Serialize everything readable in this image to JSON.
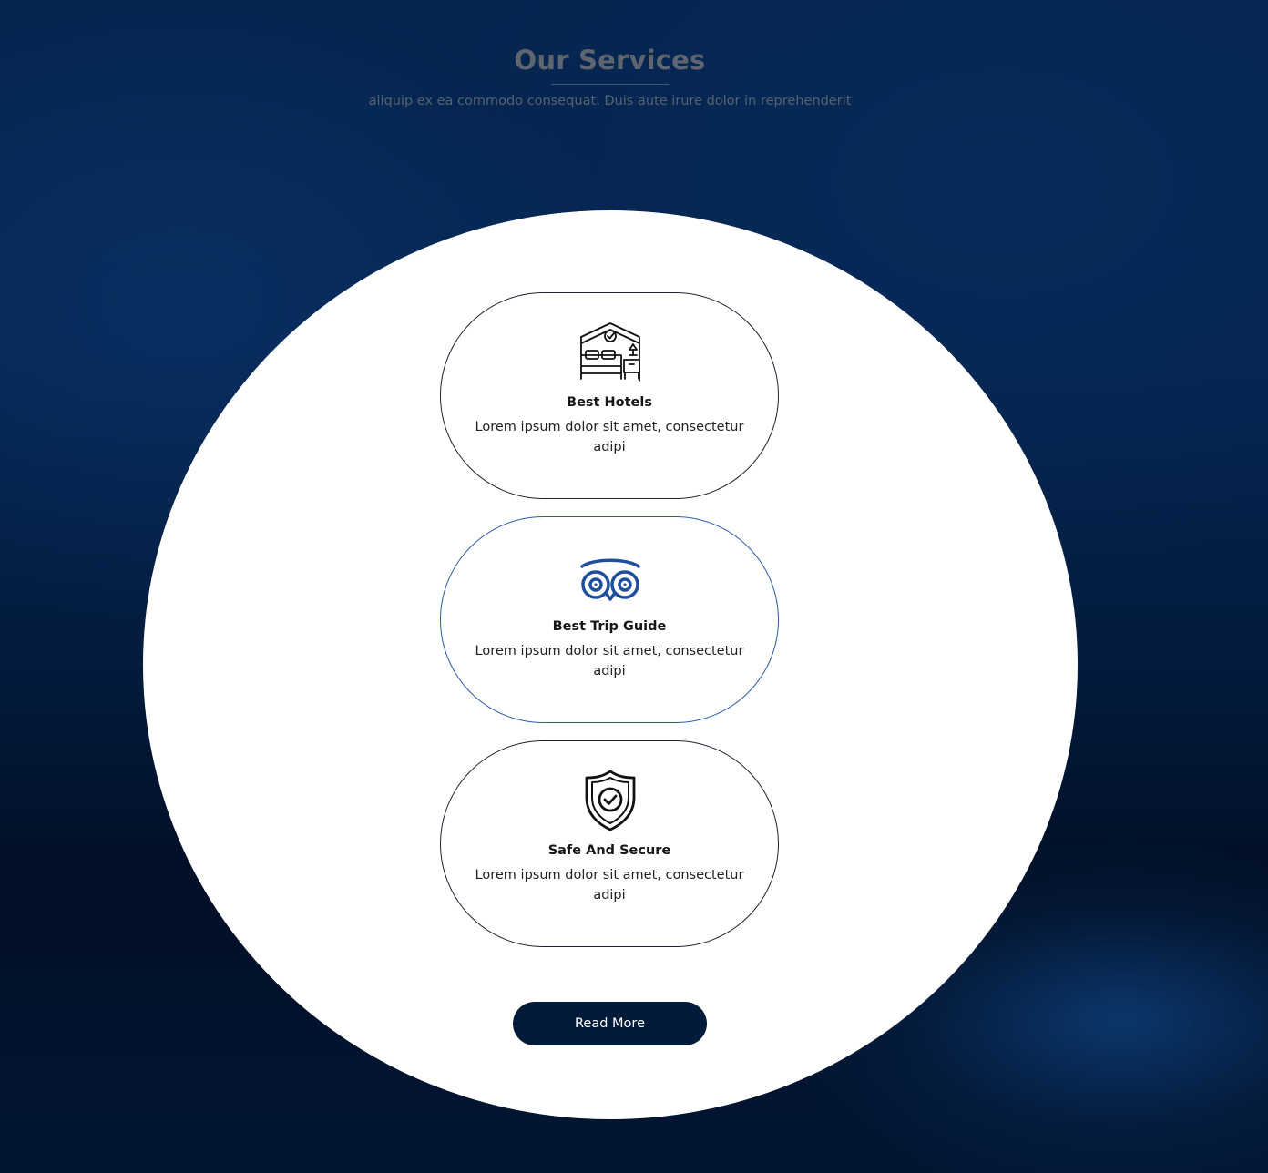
{
  "header": {
    "title": "Our Services",
    "subtitle": "aliquip ex ea commodo consequat. Duis aute irure dolor in reprehenderit"
  },
  "services": [
    {
      "icon": "hotel-icon",
      "title": "Best Hotels",
      "text": "Lorem ipsum dolor sit amet, consectetur adipi"
    },
    {
      "icon": "tripadvisor-owl-icon",
      "title": "Best Trip Guide",
      "text": "Lorem ipsum dolor sit amet, consectetur adipi"
    },
    {
      "icon": "shield-check-icon",
      "title": "Safe And Secure",
      "text": "Lorem ipsum dolor sit amet, consectetur adipi"
    }
  ],
  "button": {
    "label": "Read More"
  },
  "colors": {
    "background": "#052551",
    "title": "#5c6570",
    "button_bg": "#031b3b",
    "accent_blue": "#2a5ba8"
  }
}
